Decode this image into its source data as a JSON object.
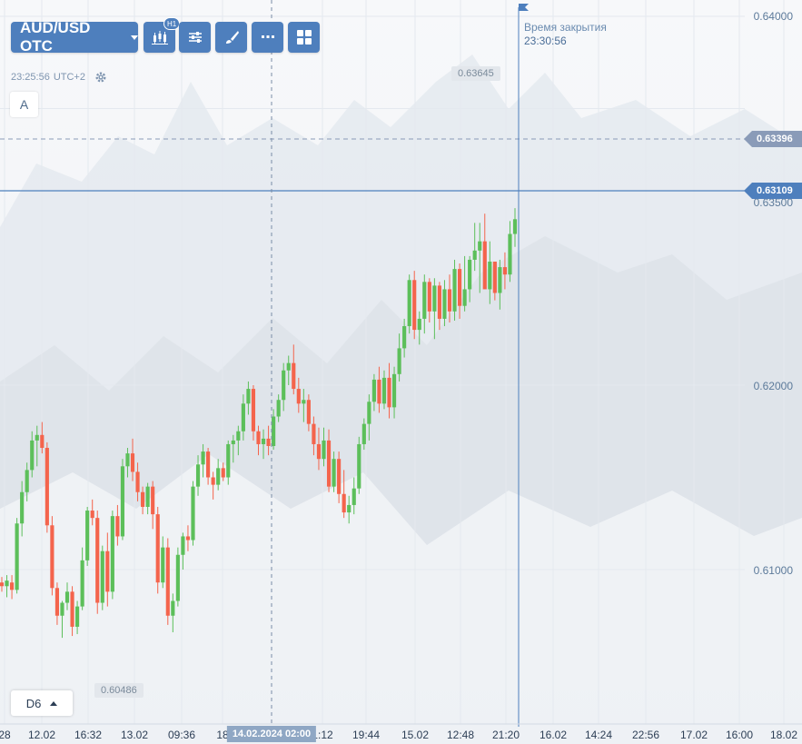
{
  "toolbar": {
    "asset_label": "AUD/USD OTC",
    "timeframe_badge": "H1",
    "buttons": [
      "candles-type",
      "indicators",
      "drawings",
      "more",
      "layouts"
    ]
  },
  "clock": {
    "time": "23:25:56",
    "timezone": "UTC+2"
  },
  "mode_button_label": "A",
  "closing": {
    "label": "Время закрытия",
    "time": "23:30:56"
  },
  "price_axis": [
    "0.64000",
    "0.63500",
    "0.62000",
    "0.61000"
  ],
  "price_tags": {
    "current": "0.63109",
    "dashed": "0.63396",
    "high_label": "0.63645",
    "low_label": "0.60486"
  },
  "time_axis": [
    "28",
    "12.02",
    "16:32",
    "13.02",
    "09:36",
    "18",
    "1:12",
    "19:44",
    "15.02",
    "12:48",
    "21:20",
    "16.02",
    "14:24",
    "22:56",
    "17.02",
    "16:00",
    "18.02"
  ],
  "crosshair_time": "14.02.2024 02:00",
  "period_selector": "D6",
  "colors": {
    "up": "#5cbf5a",
    "down": "#f4644c",
    "accent": "#4e7fbd",
    "grid": "#e4e9ef"
  },
  "chart_data": {
    "type": "candlestick",
    "ylim": [
      0.6008,
      0.6408
    ],
    "current_price": 0.63109,
    "candles": [
      [
        0.6093,
        0.6096,
        0.6088,
        0.6091
      ],
      [
        0.6091,
        0.6097,
        0.6085,
        0.6094
      ],
      [
        0.6093,
        0.6097,
        0.6084,
        0.6089
      ],
      [
        0.6089,
        0.6128,
        0.6087,
        0.6125
      ],
      [
        0.6125,
        0.6148,
        0.6118,
        0.6142
      ],
      [
        0.6142,
        0.6158,
        0.6137,
        0.6154
      ],
      [
        0.6154,
        0.6175,
        0.615,
        0.617
      ],
      [
        0.617,
        0.6178,
        0.6156,
        0.6173
      ],
      [
        0.6173,
        0.618,
        0.6163,
        0.6166
      ],
      [
        0.6166,
        0.6169,
        0.612,
        0.6124
      ],
      [
        0.6124,
        0.6129,
        0.6086,
        0.609
      ],
      [
        0.609,
        0.6093,
        0.607,
        0.6075
      ],
      [
        0.6075,
        0.6083,
        0.6063,
        0.6082
      ],
      [
        0.6082,
        0.6093,
        0.6078,
        0.6088
      ],
      [
        0.6088,
        0.6091,
        0.6064,
        0.6069
      ],
      [
        0.6069,
        0.6083,
        0.6065,
        0.608
      ],
      [
        0.608,
        0.6112,
        0.6078,
        0.6105
      ],
      [
        0.6105,
        0.6134,
        0.6102,
        0.6132
      ],
      [
        0.6132,
        0.6138,
        0.6124,
        0.6128
      ],
      [
        0.6128,
        0.6132,
        0.6076,
        0.6082
      ],
      [
        0.6082,
        0.6113,
        0.6078,
        0.611
      ],
      [
        0.611,
        0.612,
        0.608,
        0.6088
      ],
      [
        0.6088,
        0.6132,
        0.6084,
        0.6129
      ],
      [
        0.6129,
        0.6135,
        0.6113,
        0.6118
      ],
      [
        0.6118,
        0.616,
        0.6116,
        0.6156
      ],
      [
        0.6156,
        0.6166,
        0.615,
        0.6163
      ],
      [
        0.6163,
        0.6171,
        0.6148,
        0.6153
      ],
      [
        0.6153,
        0.6158,
        0.6137,
        0.6142
      ],
      [
        0.6142,
        0.6145,
        0.613,
        0.6134
      ],
      [
        0.6134,
        0.6147,
        0.613,
        0.6145
      ],
      [
        0.6145,
        0.6148,
        0.6122,
        0.613
      ],
      [
        0.613,
        0.6134,
        0.6087,
        0.6093
      ],
      [
        0.6093,
        0.6118,
        0.609,
        0.6112
      ],
      [
        0.6112,
        0.6117,
        0.607,
        0.6075
      ],
      [
        0.6075,
        0.6087,
        0.6066,
        0.6083
      ],
      [
        0.6083,
        0.6112,
        0.608,
        0.6108
      ],
      [
        0.6108,
        0.612,
        0.61,
        0.6118
      ],
      [
        0.6118,
        0.6124,
        0.611,
        0.6116
      ],
      [
        0.6116,
        0.6148,
        0.6113,
        0.6145
      ],
      [
        0.6145,
        0.6162,
        0.614,
        0.6157
      ],
      [
        0.6157,
        0.6168,
        0.615,
        0.6164
      ],
      [
        0.6164,
        0.6166,
        0.6146,
        0.615
      ],
      [
        0.615,
        0.6153,
        0.6138,
        0.6146
      ],
      [
        0.6146,
        0.616,
        0.6143,
        0.6155
      ],
      [
        0.6155,
        0.6158,
        0.6148,
        0.615
      ],
      [
        0.615,
        0.617,
        0.6146,
        0.6168
      ],
      [
        0.6168,
        0.6173,
        0.6158,
        0.617
      ],
      [
        0.617,
        0.6178,
        0.6162,
        0.6175
      ],
      [
        0.6175,
        0.6195,
        0.617,
        0.619
      ],
      [
        0.619,
        0.6202,
        0.6184,
        0.6198
      ],
      [
        0.6198,
        0.62,
        0.617,
        0.6175
      ],
      [
        0.6175,
        0.6178,
        0.6162,
        0.6168
      ],
      [
        0.6168,
        0.6176,
        0.616,
        0.6171
      ],
      [
        0.6171,
        0.6178,
        0.6162,
        0.6167
      ],
      [
        0.6167,
        0.6187,
        0.6165,
        0.6183
      ],
      [
        0.6183,
        0.6195,
        0.618,
        0.6192
      ],
      [
        0.6192,
        0.6212,
        0.6186,
        0.6208
      ],
      [
        0.6208,
        0.6216,
        0.62,
        0.6212
      ],
      [
        0.6212,
        0.6222,
        0.6195,
        0.6198
      ],
      [
        0.6198,
        0.6204,
        0.6185,
        0.619
      ],
      [
        0.619,
        0.6198,
        0.618,
        0.6192
      ],
      [
        0.6192,
        0.6195,
        0.6175,
        0.6179
      ],
      [
        0.6179,
        0.6183,
        0.6162,
        0.6168
      ],
      [
        0.6168,
        0.6177,
        0.6154,
        0.616
      ],
      [
        0.616,
        0.6177,
        0.6156,
        0.617
      ],
      [
        0.617,
        0.6176,
        0.6142,
        0.6145
      ],
      [
        0.6145,
        0.6164,
        0.6142,
        0.616
      ],
      [
        0.616,
        0.6164,
        0.6136,
        0.6141
      ],
      [
        0.6141,
        0.6154,
        0.6128,
        0.6131
      ],
      [
        0.6131,
        0.614,
        0.6125,
        0.6135
      ],
      [
        0.6135,
        0.615,
        0.613,
        0.6144
      ],
      [
        0.6144,
        0.6172,
        0.6141,
        0.6168
      ],
      [
        0.6168,
        0.6182,
        0.6165,
        0.6179
      ],
      [
        0.6179,
        0.6195,
        0.617,
        0.6191
      ],
      [
        0.6191,
        0.6206,
        0.6186,
        0.6203
      ],
      [
        0.6203,
        0.621,
        0.6185,
        0.619
      ],
      [
        0.619,
        0.6208,
        0.6187,
        0.6204
      ],
      [
        0.6204,
        0.6212,
        0.6182,
        0.6188
      ],
      [
        0.6188,
        0.621,
        0.6182,
        0.6206
      ],
      [
        0.6206,
        0.6228,
        0.6202,
        0.622
      ],
      [
        0.622,
        0.6236,
        0.6215,
        0.6232
      ],
      [
        0.6232,
        0.626,
        0.6228,
        0.6257
      ],
      [
        0.6257,
        0.6262,
        0.6225,
        0.623
      ],
      [
        0.623,
        0.624,
        0.6222,
        0.6236
      ],
      [
        0.6236,
        0.626,
        0.6228,
        0.6256
      ],
      [
        0.6256,
        0.6258,
        0.6234,
        0.624
      ],
      [
        0.624,
        0.6258,
        0.6225,
        0.6254
      ],
      [
        0.6254,
        0.6256,
        0.623,
        0.6236
      ],
      [
        0.6236,
        0.6257,
        0.6232,
        0.6252
      ],
      [
        0.6252,
        0.626,
        0.6234,
        0.624
      ],
      [
        0.624,
        0.6268,
        0.6235,
        0.6263
      ],
      [
        0.6263,
        0.6266,
        0.6236,
        0.6243
      ],
      [
        0.6243,
        0.627,
        0.624,
        0.6252
      ],
      [
        0.6252,
        0.627,
        0.6245,
        0.6268
      ],
      [
        0.6268,
        0.6288,
        0.6262,
        0.6273
      ],
      [
        0.6273,
        0.6288,
        0.625,
        0.6278
      ],
      [
        0.6278,
        0.6293,
        0.6262,
        0.6252
      ],
      [
        0.6252,
        0.6278,
        0.6244,
        0.6267
      ],
      [
        0.6267,
        0.6265,
        0.6246,
        0.625
      ],
      [
        0.625,
        0.6268,
        0.6241,
        0.6264
      ],
      [
        0.6264,
        0.6272,
        0.6252,
        0.626
      ],
      [
        0.626,
        0.6289,
        0.6256,
        0.6282
      ],
      [
        0.6282,
        0.6296,
        0.6275,
        0.629
      ]
    ]
  }
}
